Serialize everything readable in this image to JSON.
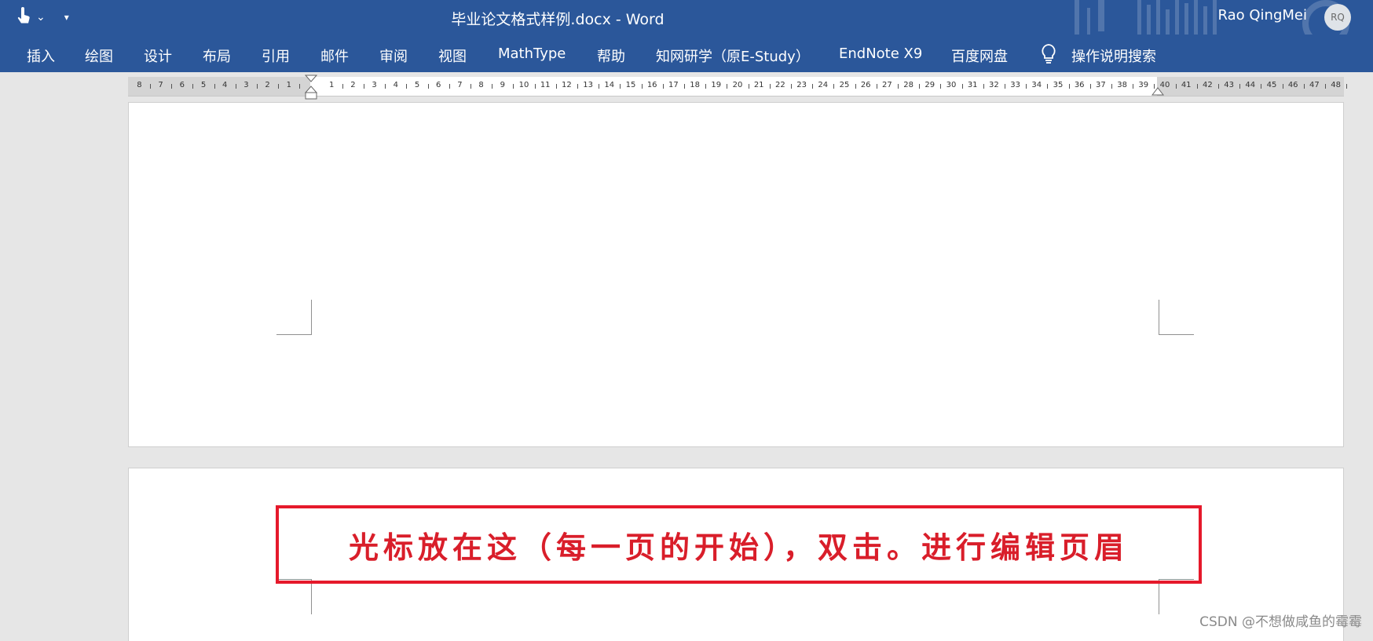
{
  "titlebar": {
    "title": "毕业论文格式样例.docx  -  Word",
    "user_name": "Rao QingMei",
    "avatar_initials": "RQ",
    "qat_chevron": "⌄",
    "qat_customize": "▾",
    "background_color": "#2b579a"
  },
  "ribbon": {
    "tabs": [
      {
        "label": "插入"
      },
      {
        "label": "绘图"
      },
      {
        "label": "设计"
      },
      {
        "label": "布局"
      },
      {
        "label": "引用"
      },
      {
        "label": "邮件"
      },
      {
        "label": "审阅"
      },
      {
        "label": "视图"
      },
      {
        "label": "MathType"
      },
      {
        "label": "帮助"
      },
      {
        "label": "知网研学（原E-Study）"
      },
      {
        "label": "EndNote X9"
      },
      {
        "label": "百度网盘"
      }
    ],
    "tell_me_label": "操作说明搜索",
    "tell_me_icon": "lightbulb-icon"
  },
  "ruler": {
    "left_numbers": [
      "8",
      "7",
      "6",
      "5",
      "4",
      "3",
      "2",
      "1"
    ],
    "right_numbers": [
      "1",
      "2",
      "3",
      "4",
      "5",
      "6",
      "7",
      "8",
      "9",
      "10",
      "11",
      "12",
      "13",
      "14",
      "15",
      "16",
      "17",
      "18",
      "19",
      "20",
      "21",
      "22",
      "23",
      "24",
      "25",
      "26",
      "27",
      "28",
      "29",
      "30",
      "31",
      "32",
      "33",
      "34",
      "35",
      "36",
      "37",
      "38",
      "39",
      "40",
      "41",
      "42",
      "43",
      "44",
      "45",
      "46",
      "47",
      "48"
    ]
  },
  "callout": {
    "text": "光标放在这（每一页的开始），双击。进行编辑页眉",
    "color": "#e5192b"
  },
  "watermark": "CSDN @不想做咸鱼的霉霉"
}
